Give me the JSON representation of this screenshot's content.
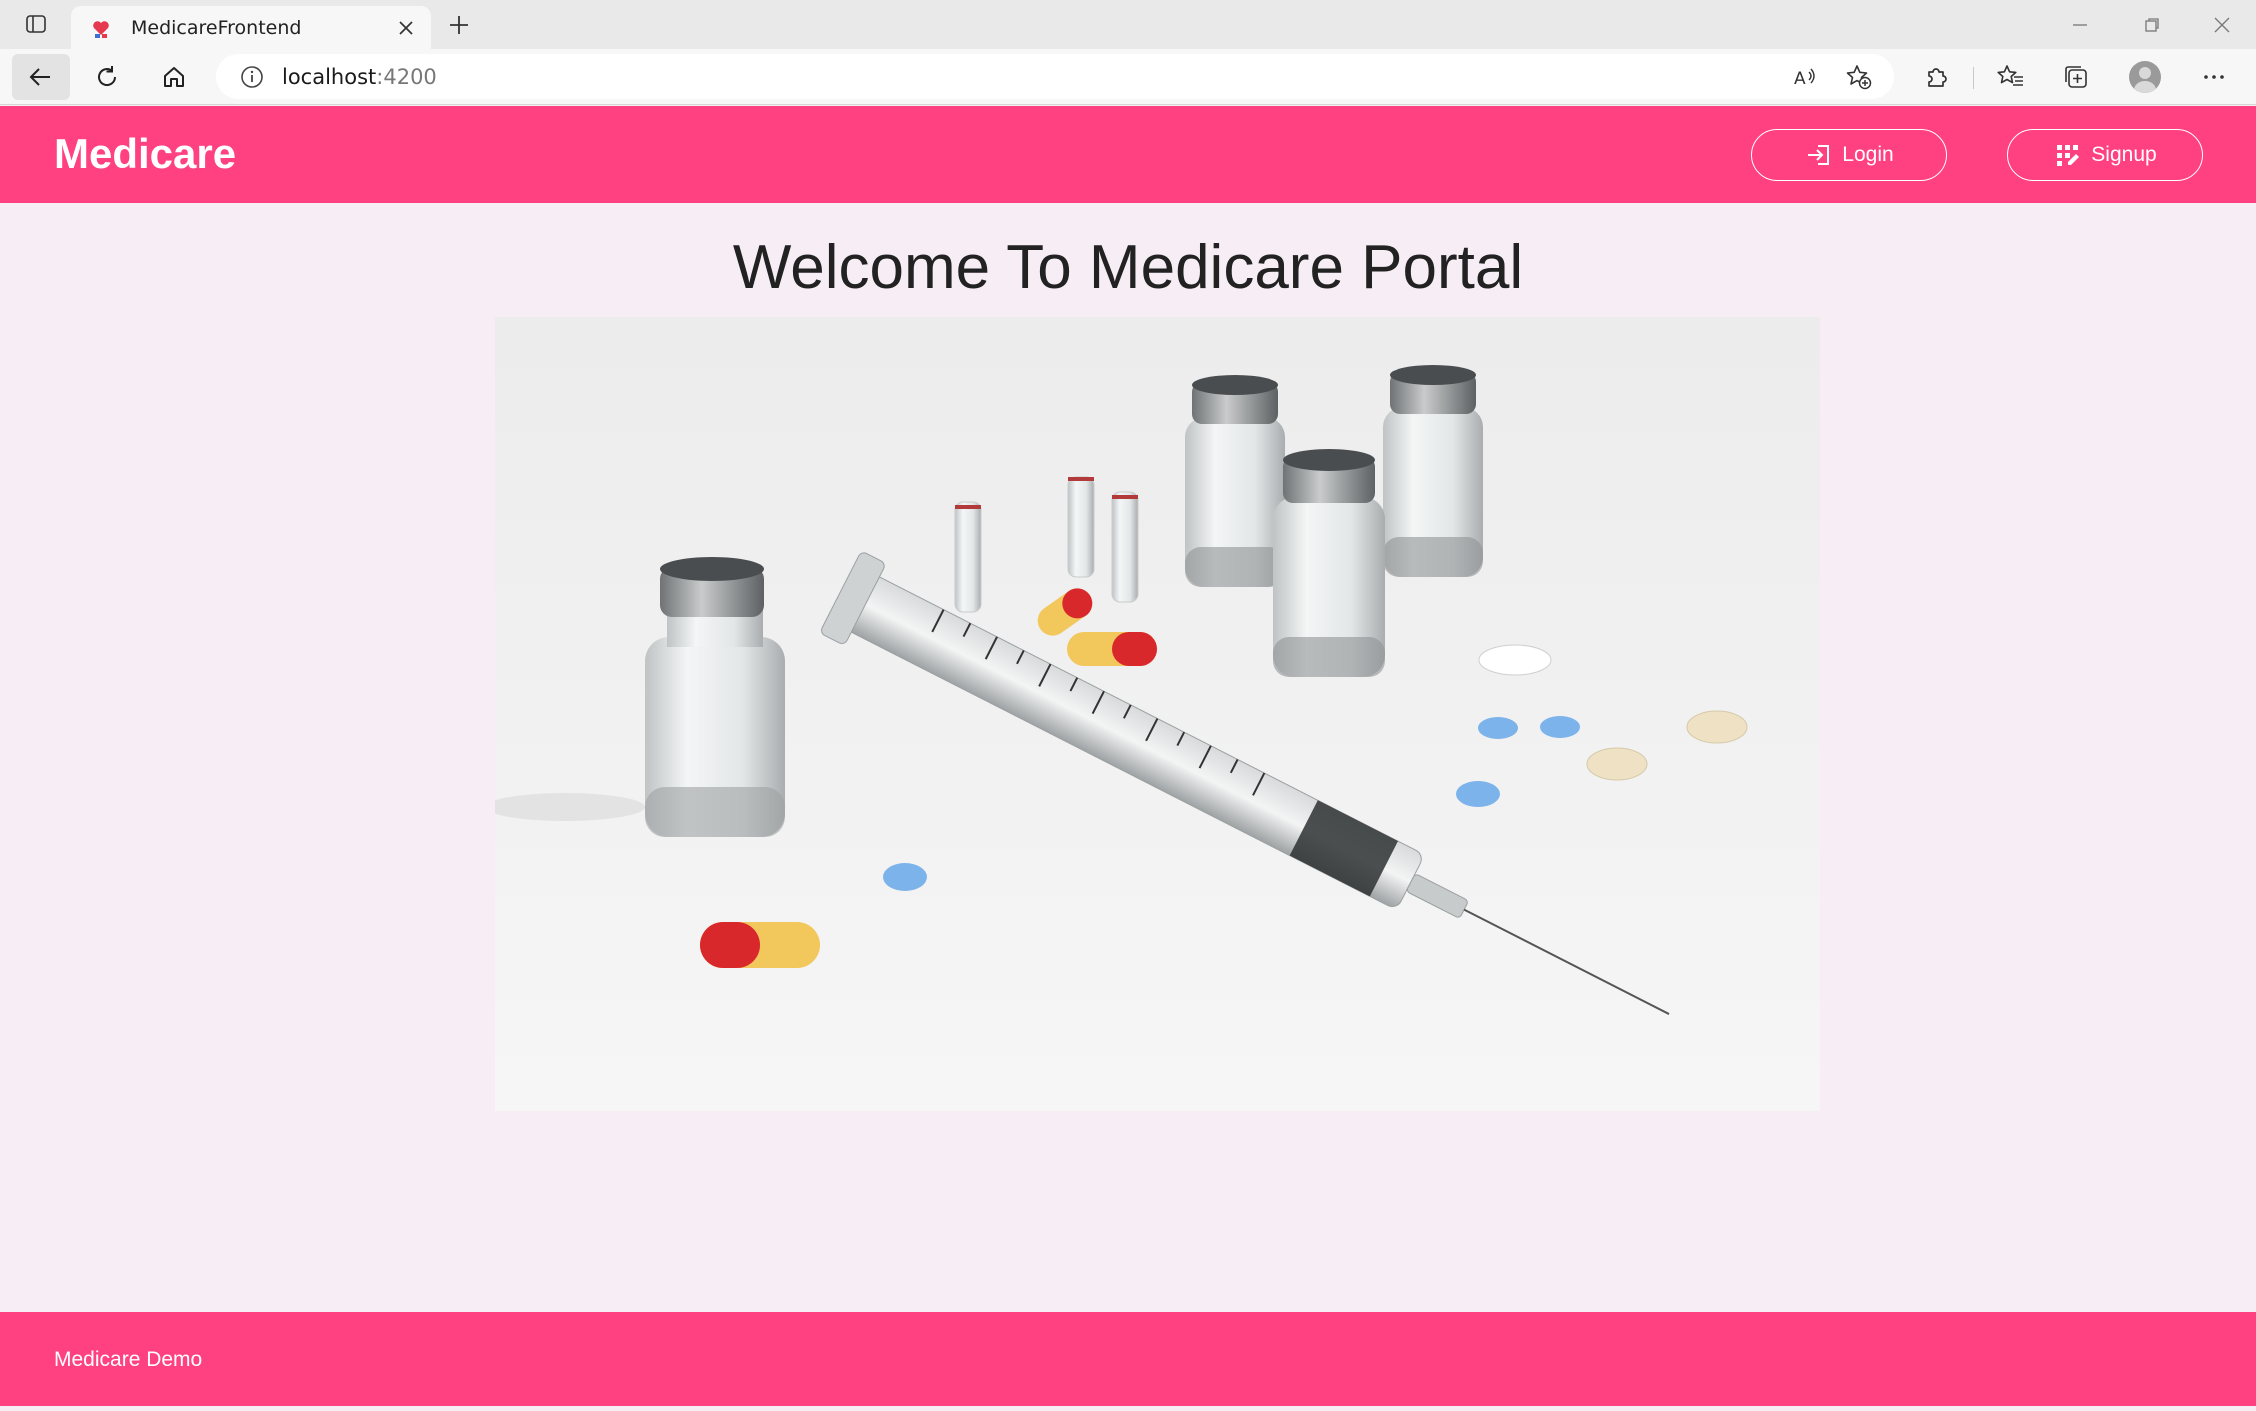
{
  "browser": {
    "tab_title": "MedicareFrontend",
    "address_host": "localhost",
    "address_port": ":4200"
  },
  "header": {
    "brand": "Medicare",
    "login_label": "Login",
    "signup_label": "Signup",
    "accent_color": "#ff4081"
  },
  "main": {
    "title": "Welcome To Medicare Portal"
  },
  "footer": {
    "text": "Medicare Demo"
  },
  "icons": [
    "sidebar-toggle-icon",
    "favicon-icon",
    "close-icon",
    "plus-icon",
    "minimize-icon",
    "restore-icon",
    "back-arrow-icon",
    "refresh-icon",
    "home-icon",
    "info-icon",
    "read-aloud-icon",
    "add-favorite-icon",
    "extensions-icon",
    "favorites-icon",
    "collections-icon",
    "profile-icon",
    "more-icon",
    "login-icon",
    "signup-icon"
  ]
}
